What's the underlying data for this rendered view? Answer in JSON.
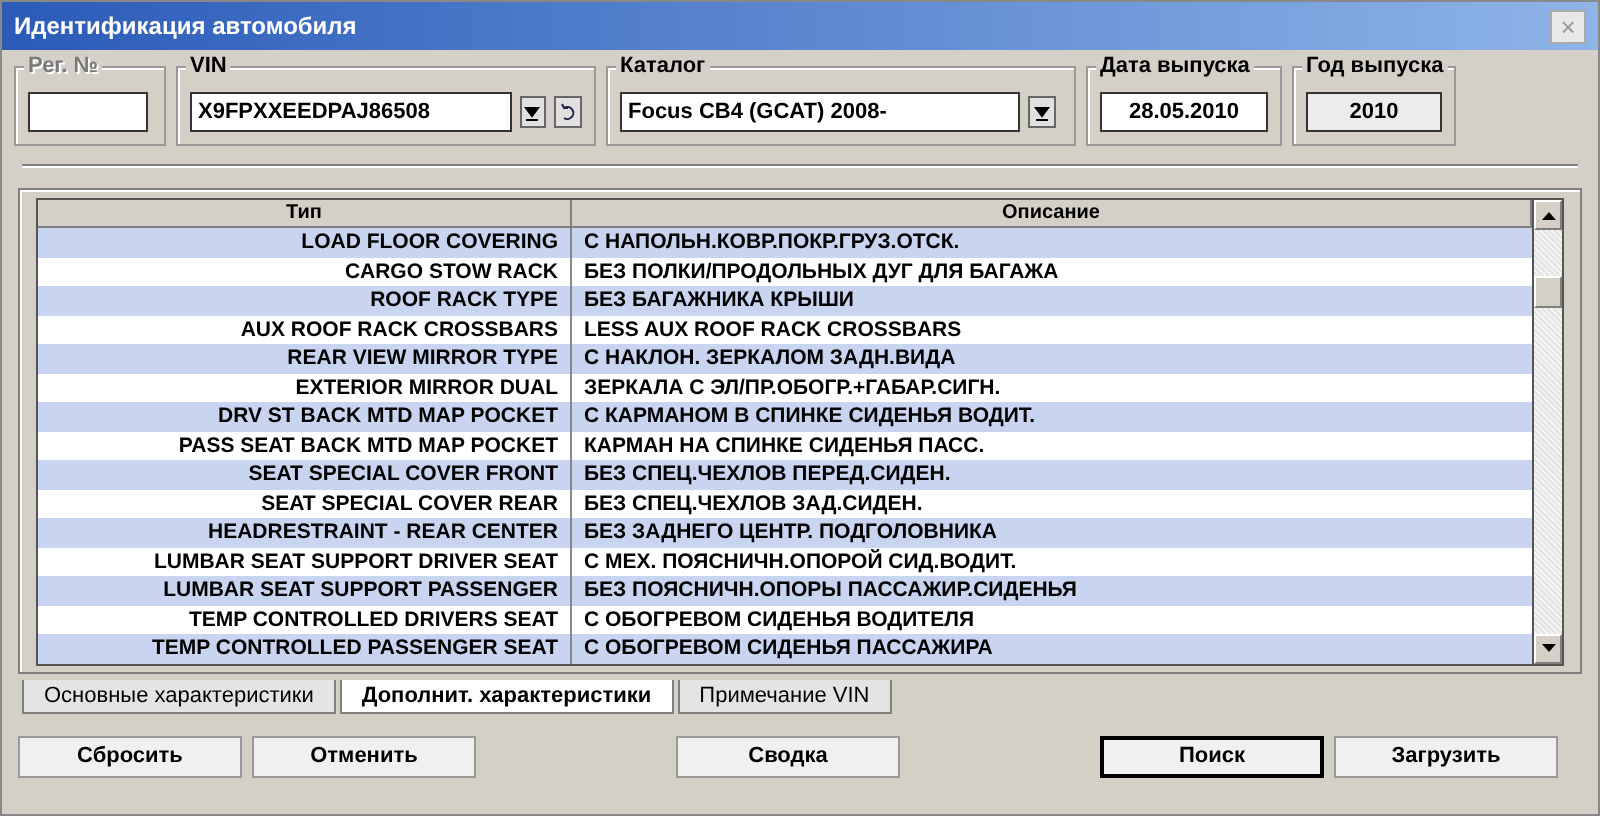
{
  "window": {
    "title": "Идентификация автомобиля",
    "close": "×"
  },
  "fields": [
    {
      "label": "Рег. №",
      "disabled": true,
      "kind": "text"
    },
    {
      "label": "VIN",
      "value": "X9FPXXEEDPAJ86508",
      "disabled": false,
      "kind": "vin"
    },
    {
      "label": "Каталог",
      "value": "Focus CB4 (GCAT) 2008-",
      "disabled": false,
      "kind": "combo"
    },
    {
      "label": "Дата выпуска",
      "value": "28.05.2010",
      "disabled": false,
      "kind": "date"
    },
    {
      "label": "Год выпуска",
      "value": "2010",
      "disabled": false,
      "kind": "readonly"
    }
  ],
  "table": {
    "columns": [
      "Тип",
      "Описание"
    ],
    "rows": [
      [
        "LOAD FLOOR COVERING",
        "С НАПОЛЬН.КОВР.ПОКР.ГРУЗ.ОТСК."
      ],
      [
        "CARGO STOW RACK",
        "БЕЗ ПОЛКИ/ПРОДОЛЬНЫХ ДУГ ДЛЯ БАГАЖА"
      ],
      [
        "ROOF RACK TYPE",
        "БЕЗ БАГАЖНИКА КРЫШИ"
      ],
      [
        "AUX ROOF RACK CROSSBARS",
        "LESS AUX ROOF RACK CROSSBARS"
      ],
      [
        "REAR VIEW MIRROR TYPE",
        "С НАКЛОН. ЗЕРКАЛОМ ЗАДН.ВИДА"
      ],
      [
        "EXTERIOR MIRROR DUAL",
        "ЗЕРКАЛА С ЭЛ/ПР.ОБОГР.+ГАБАР.СИГН."
      ],
      [
        "DRV ST BACK MTD MAP POCKET",
        "С КАРМАНОМ В СПИНКЕ СИДЕНЬЯ ВОДИТ."
      ],
      [
        "PASS SEAT BACK MTD MAP POCKET",
        "КАРМАН НА СПИНКЕ СИДЕНЬЯ ПАСС."
      ],
      [
        "SEAT SPECIAL COVER FRONT",
        "БЕЗ СПЕЦ.ЧЕХЛОВ ПЕРЕД.СИДЕН."
      ],
      [
        "SEAT SPECIAL COVER REAR",
        "БЕЗ СПЕЦ.ЧЕХЛОВ ЗАД.СИДЕН."
      ],
      [
        "HEADRESTRAINT - REAR CENTER",
        "БЕЗ ЗАДНЕГО ЦЕНТР. ПОДГОЛОВНИКА"
      ],
      [
        "LUMBAR SEAT SUPPORT DRIVER SEAT",
        "С МЕХ. ПОЯСНИЧН.ОПОРОЙ СИД.ВОДИТ."
      ],
      [
        "LUMBAR SEAT SUPPORT PASSENGER",
        "БЕЗ ПОЯСНИЧН.ОПОРЫ ПАССАЖИР.СИДЕНЬЯ"
      ],
      [
        "TEMP CONTROLLED DRIVERS SEAT",
        "С ОБОГРЕВОМ СИДЕНЬЯ ВОДИТЕЛЯ"
      ],
      [
        "TEMP CONTROLLED PASSENGER SEAT",
        "С ОБОГРЕВОМ СИДЕНЬЯ ПАССАЖИРА"
      ]
    ]
  },
  "tabs": [
    {
      "label": "Основные характеристики",
      "selected": false
    },
    {
      "label": "Дополнит. характеристики",
      "selected": true
    },
    {
      "label": "Примечание VIN",
      "selected": false
    }
  ],
  "buttons": [
    {
      "label": "Сбросить",
      "default": false
    },
    {
      "label": "Отменить",
      "default": false
    },
    {
      "label": "Сводка",
      "default": false
    },
    {
      "label": "Поиск",
      "default": true
    },
    {
      "label": "Загрузить",
      "default": false
    }
  ]
}
